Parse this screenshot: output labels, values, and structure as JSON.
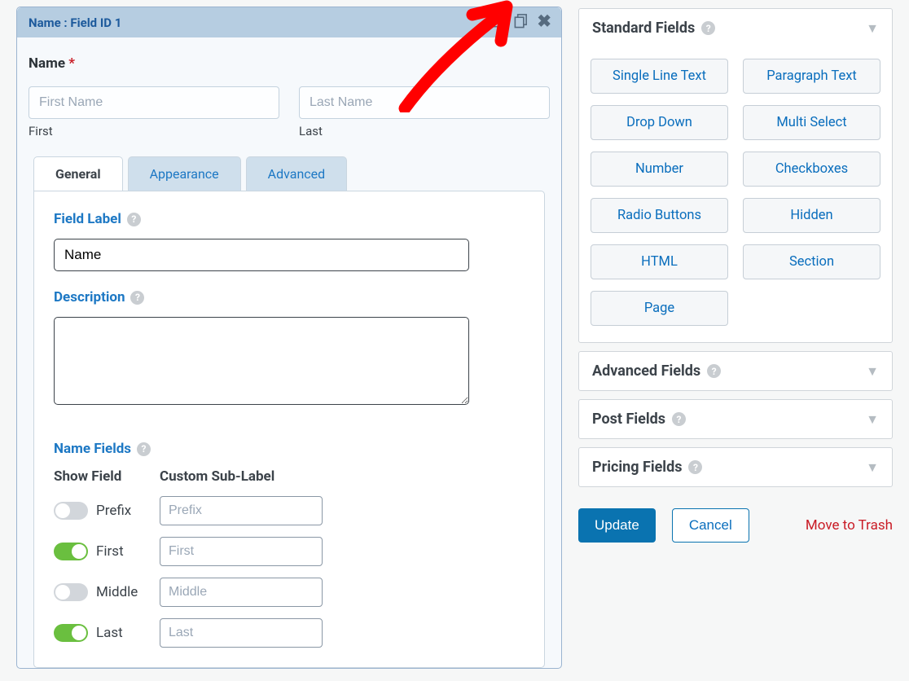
{
  "field_header": "Name : Field ID 1",
  "field_title": "Name",
  "name_preview": {
    "first_placeholder": "First Name",
    "first_sub": "First",
    "last_placeholder": "Last Name",
    "last_sub": "Last"
  },
  "tabs": {
    "general": "General",
    "appearance": "Appearance",
    "advanced": "Advanced"
  },
  "general": {
    "field_label_title": "Field Label",
    "field_label_value": "Name",
    "description_title": "Description",
    "description_value": "",
    "name_fields_title": "Name Fields",
    "show_field_head": "Show Field",
    "custom_sub_head": "Custom Sub-Label",
    "rows": [
      {
        "label": "Prefix",
        "on": false,
        "placeholder": "Prefix"
      },
      {
        "label": "First",
        "on": true,
        "placeholder": "First"
      },
      {
        "label": "Middle",
        "on": false,
        "placeholder": "Middle"
      },
      {
        "label": "Last",
        "on": true,
        "placeholder": "Last"
      }
    ]
  },
  "panels": [
    {
      "title": "Standard Fields",
      "open": true,
      "items": [
        "Single Line Text",
        "Paragraph Text",
        "Drop Down",
        "Multi Select",
        "Number",
        "Checkboxes",
        "Radio Buttons",
        "Hidden",
        "HTML",
        "Section",
        "Page"
      ]
    },
    {
      "title": "Advanced Fields",
      "open": false
    },
    {
      "title": "Post Fields",
      "open": false
    },
    {
      "title": "Pricing Fields",
      "open": false
    }
  ],
  "actions": {
    "update": "Update",
    "cancel": "Cancel",
    "trash": "Move to Trash"
  }
}
